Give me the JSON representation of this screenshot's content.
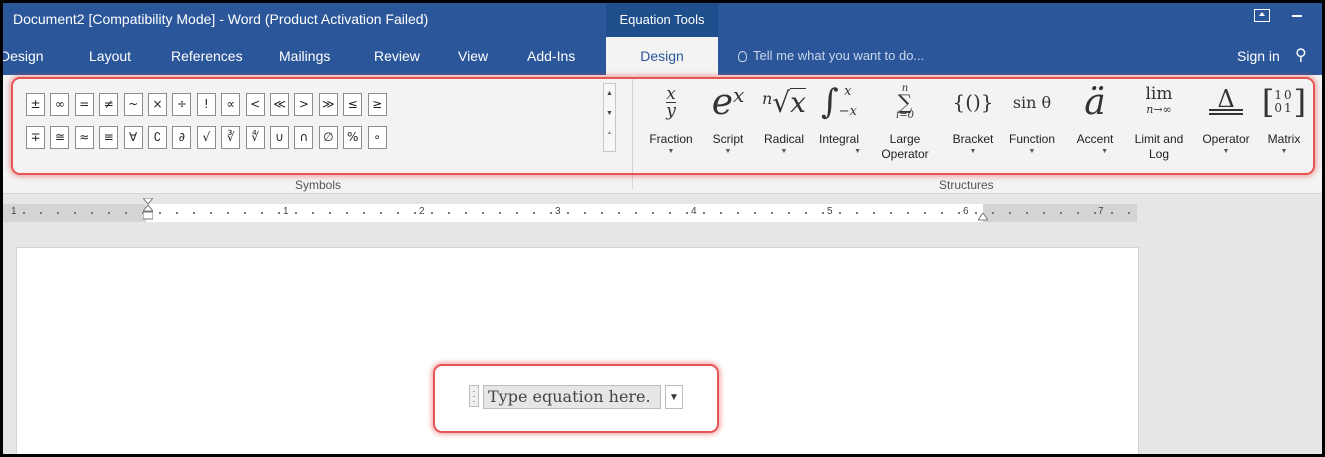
{
  "titlebar": {
    "title": "Document2 [Compatibility Mode] - Word (Product Activation Failed)",
    "context_tab": "Equation Tools"
  },
  "tabs": [
    {
      "label": "Design"
    },
    {
      "label": "Layout"
    },
    {
      "label": "References"
    },
    {
      "label": "Mailings"
    },
    {
      "label": "Review"
    },
    {
      "label": "View"
    },
    {
      "label": "Add-Ins"
    }
  ],
  "active_tab": "Design",
  "tellme": {
    "placeholder": "Tell me what you want to do..."
  },
  "signin": "Sign in",
  "symbols": {
    "group_label": "Symbols",
    "row1": [
      "±",
      "∞",
      "=",
      "≠",
      "~",
      "×",
      "÷",
      "!",
      "∝",
      "<",
      "≪",
      ">",
      "≫",
      "≤",
      "≥"
    ],
    "row2": [
      "∓",
      "≅",
      "≈",
      "≡",
      "∀",
      "∁",
      "∂",
      "√",
      "∛",
      "∜",
      "∪",
      "∩",
      "∅",
      "%",
      "∘"
    ]
  },
  "structures": {
    "group_label": "Structures",
    "items": [
      {
        "label": "Fraction",
        "icon": "fraction-icon"
      },
      {
        "label": "Script",
        "icon": "script-icon"
      },
      {
        "label": "Radical",
        "icon": "radical-icon"
      },
      {
        "label": "Integral",
        "icon": "integral-icon"
      },
      {
        "label": "Large\nOperator",
        "icon": "large-operator-icon"
      },
      {
        "label": "Bracket",
        "icon": "bracket-icon"
      },
      {
        "label": "Function",
        "icon": "function-icon"
      },
      {
        "label": "Accent",
        "icon": "accent-icon"
      },
      {
        "label": "Limit and\nLog",
        "icon": "limit-icon"
      },
      {
        "label": "Operator",
        "icon": "operator-icon"
      },
      {
        "label": "Matrix",
        "icon": "matrix-icon"
      }
    ]
  },
  "ruler": {
    "numbers": [
      "1",
      "1",
      "2",
      "3",
      "4",
      "5",
      "6",
      "7"
    ]
  },
  "equation": {
    "placeholder": "Type equation here."
  },
  "colors": {
    "ribbon_blue": "#2b579a",
    "highlight": "#e75454"
  }
}
